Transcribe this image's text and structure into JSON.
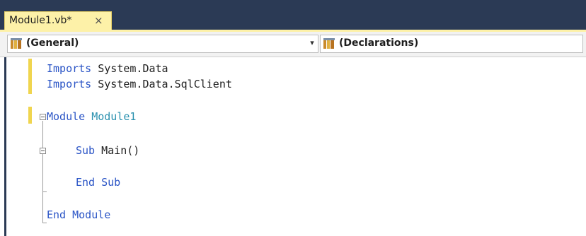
{
  "tab": {
    "title": "Module1.vb*",
    "close_glyph": "×"
  },
  "navbar": {
    "left_combo": {
      "label": "(General)",
      "icon": "class-view-icon"
    },
    "right_combo": {
      "label": "(Declarations)",
      "icon": "class-view-icon"
    },
    "arrow_glyph": "▾"
  },
  "code": {
    "line1": {
      "kw": "Imports",
      "text": " System.Data"
    },
    "line2": {
      "kw": "Imports",
      "text": " System.Data.SqlClient"
    },
    "line3": {
      "kw": "Module",
      "type": " Module1"
    },
    "line4": {
      "kw": "Sub",
      "text": " Main()"
    },
    "line5": {
      "kw": "End Sub"
    },
    "line6": {
      "kw": "End Module"
    }
  },
  "colors": {
    "tabstrip": "#2b3a55",
    "tab_active": "#fdf1a8",
    "keyword": "#2b55c6",
    "type": "#2b91af",
    "change_bar": "#f0d54f"
  }
}
